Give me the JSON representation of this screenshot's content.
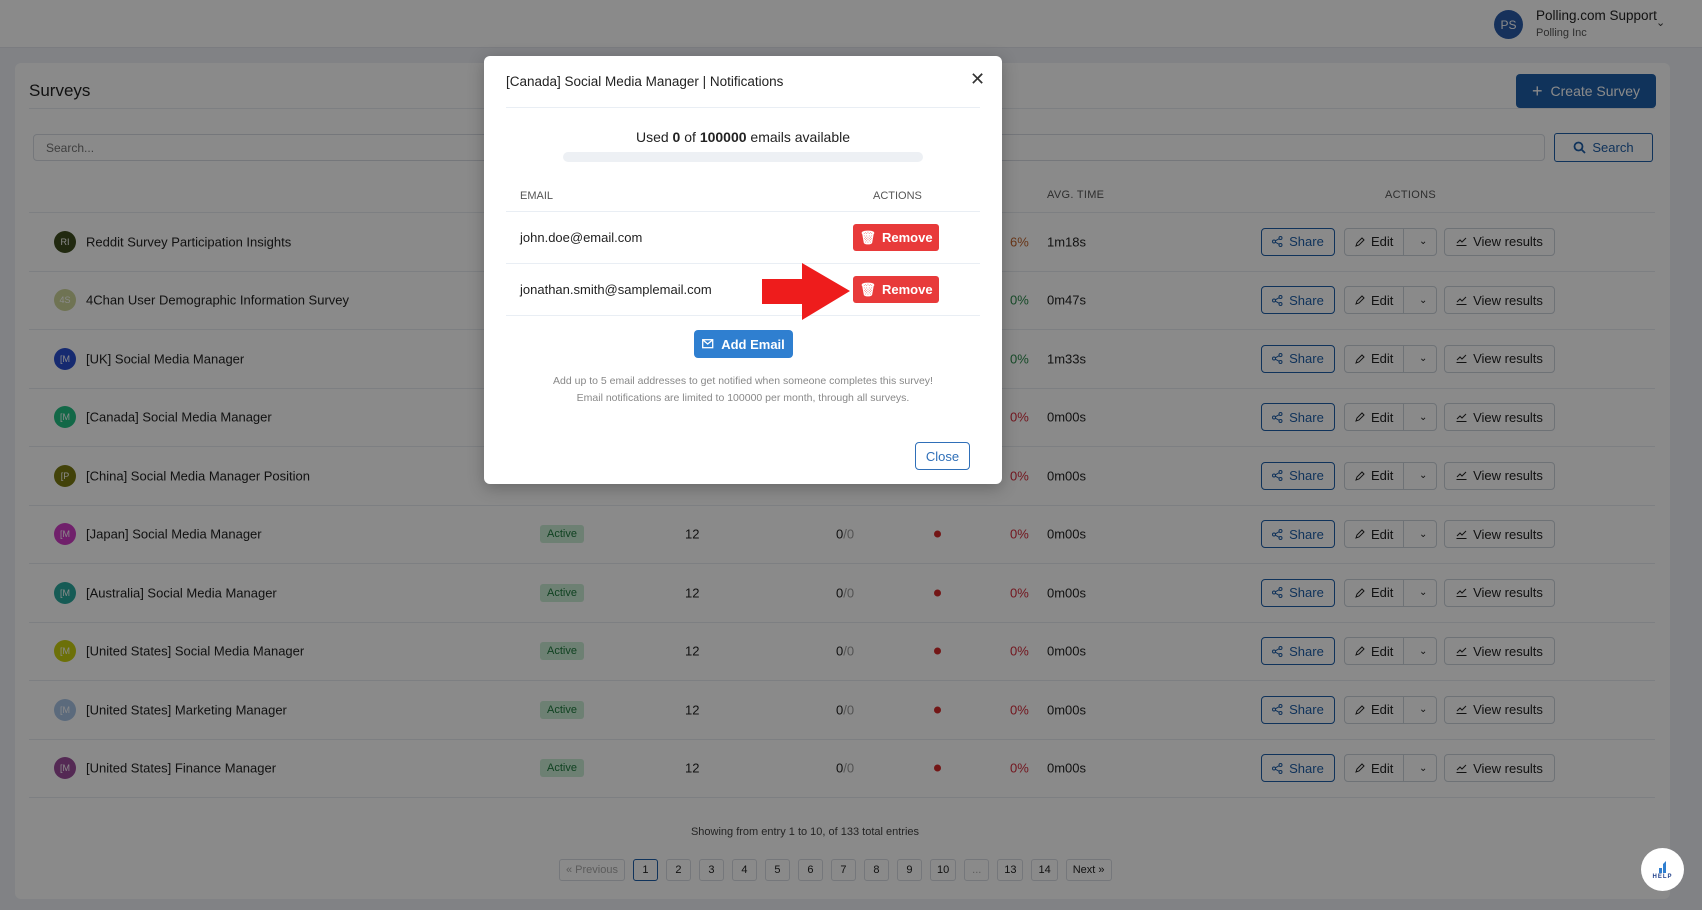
{
  "header": {
    "avatar_initials": "PS",
    "user_name": "Polling.com Support",
    "org": "Polling Inc"
  },
  "page": {
    "title": "Surveys",
    "create_label": "Create Survey",
    "search_placeholder": "Search...",
    "search_label": "Search"
  },
  "table": {
    "headers": {
      "avg_time": "AVG. TIME",
      "actions": "ACTIONS"
    },
    "action_labels": {
      "share": "Share",
      "edit": "Edit",
      "view": "View results"
    },
    "rows": [
      {
        "initials": "RI",
        "avatar_color": "#3d4d1e",
        "name": "Reddit Survey Participation Insights",
        "status": "",
        "questions": "",
        "responses": "",
        "rate": "6%",
        "rate_color": "#c0622a",
        "time": "1m18s"
      },
      {
        "initials": "4S",
        "avatar_color": "#cdd59a",
        "name": "4Chan User Demographic Information Survey",
        "status": "",
        "questions": "",
        "responses": "",
        "rate": "0%",
        "rate_color": "#2a8a4a",
        "time": "0m47s"
      },
      {
        "initials": "[M",
        "avatar_color": "#2a4fd0",
        "name": "[UK] Social Media Manager",
        "status": "",
        "questions": "",
        "responses": "",
        "rate": "0%",
        "rate_color": "#2a8a4a",
        "time": "1m33s"
      },
      {
        "initials": "[M",
        "avatar_color": "#22c084",
        "name": "[Canada] Social Media Manager",
        "status": "",
        "questions": "",
        "responses": "",
        "rate": "0%",
        "rate_color": "#d42a3a",
        "time": "0m00s"
      },
      {
        "initials": "[P",
        "avatar_color": "#7a7a12",
        "name": "[China] Social Media Manager Position",
        "status": "",
        "questions": "",
        "responses": "",
        "rate": "0%",
        "rate_color": "#d42a3a",
        "time": "0m00s"
      },
      {
        "initials": "[M",
        "avatar_color": "#d03cc6",
        "name": "[Japan] Social Media Manager",
        "status": "Active",
        "questions": "12",
        "responses": "0",
        "responses_total": "/0",
        "rate": "0%",
        "rate_color": "#d42a3a",
        "time": "0m00s"
      },
      {
        "initials": "[M",
        "avatar_color": "#2aa89e",
        "name": "[Australia] Social Media Manager",
        "status": "Active",
        "questions": "12",
        "responses": "0",
        "responses_total": "/0",
        "rate": "0%",
        "rate_color": "#d42a3a",
        "time": "0m00s"
      },
      {
        "initials": "[M",
        "avatar_color": "#c8d010",
        "name": "[United States] Social Media Manager",
        "status": "Active",
        "questions": "12",
        "responses": "0",
        "responses_total": "/0",
        "rate": "0%",
        "rate_color": "#d42a3a",
        "time": "0m00s"
      },
      {
        "initials": "[M",
        "avatar_color": "#a8c4e6",
        "name": "[United States] Marketing Manager",
        "status": "Active",
        "questions": "12",
        "responses": "0",
        "responses_total": "/0",
        "rate": "0%",
        "rate_color": "#d42a3a",
        "time": "0m00s"
      },
      {
        "initials": "[M",
        "avatar_color": "#9c4c9c",
        "name": "[United States] Finance Manager",
        "status": "Active",
        "questions": "12",
        "responses": "0",
        "responses_total": "/0",
        "rate": "0%",
        "rate_color": "#d42a3a",
        "time": "0m00s"
      }
    ]
  },
  "pagination": {
    "summary": "Showing from entry 1 to 10, of 133 total entries",
    "prev": "« Previous",
    "pages": [
      "1",
      "2",
      "3",
      "4",
      "5",
      "6",
      "7",
      "8",
      "9",
      "10",
      "...",
      "13",
      "14"
    ],
    "current": "1",
    "next": "Next »"
  },
  "help_label": "HELP",
  "modal": {
    "title": "[Canada] Social Media Manager | Notifications",
    "used_prefix": "Used ",
    "used": "0",
    "used_mid": " of ",
    "limit": "100000",
    "used_suffix": " emails available",
    "usage_fraction": 0,
    "col_email": "EMAIL",
    "col_actions": "ACTIONS",
    "emails": [
      "john.doe@email.com",
      "jonathan.smith@samplemail.com"
    ],
    "remove_label": "Remove",
    "add_label": "Add Email",
    "help_line1": "Add up to 5 email addresses to get notified when someone completes this survey!",
    "help_line2": "Email notifications are limited to 100000 per month, through all surveys.",
    "close_label": "Close"
  },
  "annotation": {
    "arrow_color": "#ee1c1c"
  }
}
